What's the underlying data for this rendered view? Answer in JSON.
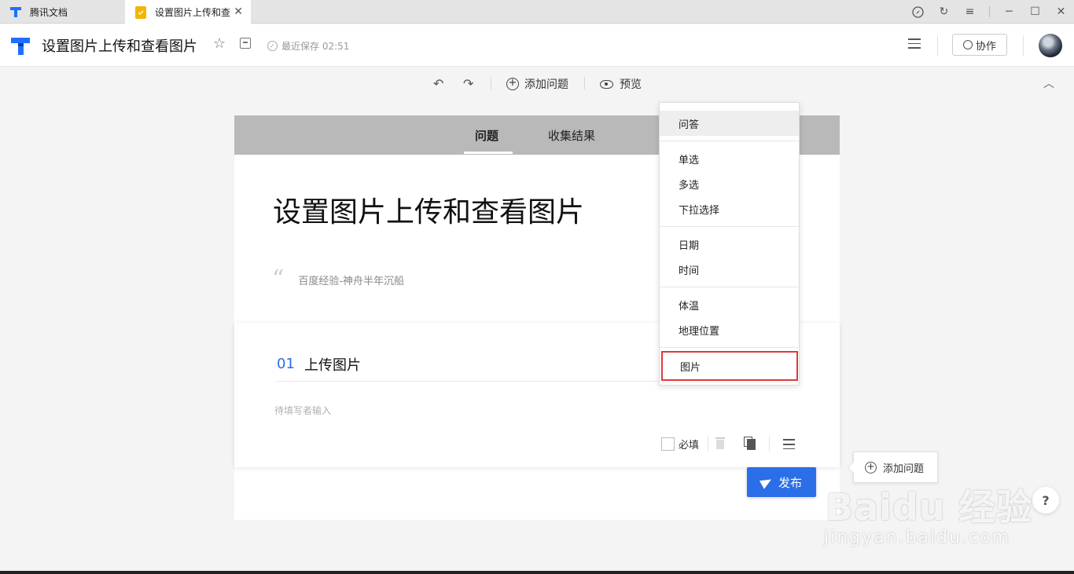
{
  "tabs": [
    {
      "label": "腾讯文档"
    },
    {
      "label": "设置图片上传和查"
    }
  ],
  "header": {
    "doc_title": "设置图片上传和查看图片",
    "saved": "最近保存 02:51",
    "collab_label": "协作"
  },
  "toolbar": {
    "add_question": "添加问题",
    "preview": "预览"
  },
  "card": {
    "tabs": [
      "问题",
      "收集结果"
    ],
    "title": "设置图片上传和查看图片",
    "description": "百度经验-神舟半年沉船",
    "question": {
      "number": "01",
      "title": "上传图片",
      "hint": "待填写者输入",
      "required_label": "必填"
    }
  },
  "dropdown": {
    "items": [
      "问答",
      "单选",
      "多选",
      "下拉选择",
      "日期",
      "时间",
      "体温",
      "地理位置",
      "图片"
    ],
    "highlighted": "图片"
  },
  "publish_label": "发布",
  "float_add_label": "添加问题",
  "help_label": "?",
  "watermark": {
    "main": "Baidu 经验",
    "sub": "jingyan.baidu.com"
  },
  "colors": {
    "accent": "#2a6ee8",
    "highlight_border": "#e03a3a",
    "tab_band": "#b9b9b9"
  }
}
